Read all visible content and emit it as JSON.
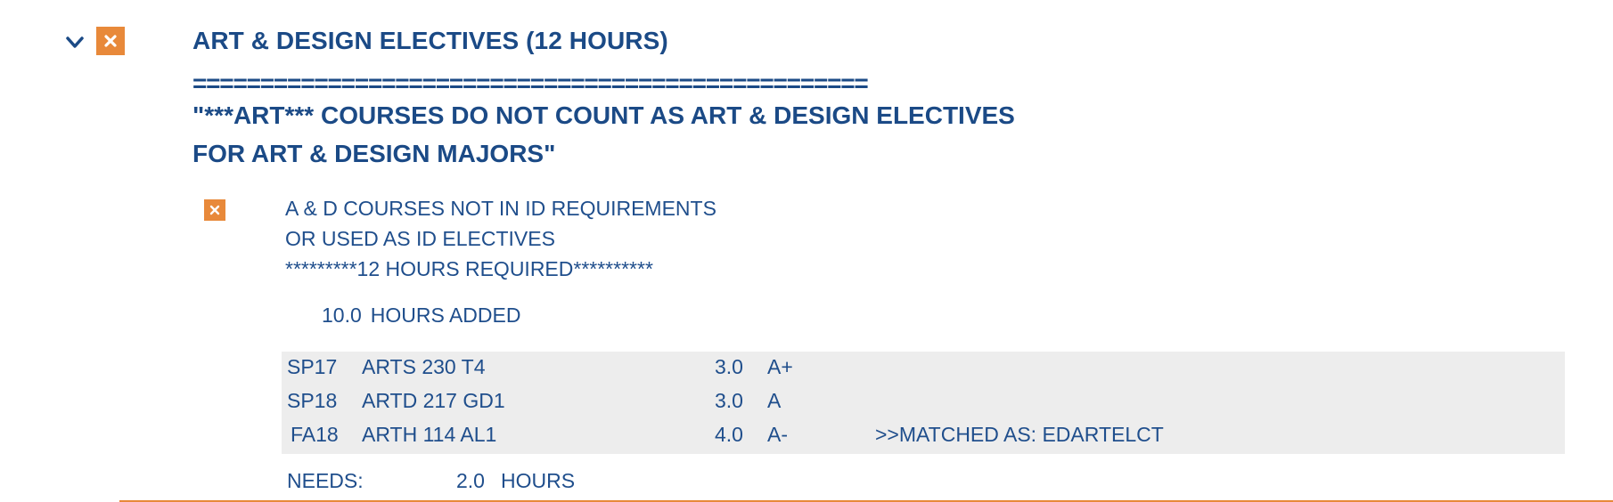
{
  "section": {
    "title": "ART & DESIGN ELECTIVES (12 HOURS)",
    "separator": "==================================================",
    "note_line_1": "\"***ART*** COURSES DO NOT COUNT AS ART & DESIGN ELECTIVES",
    "note_line_2": "FOR ART & DESIGN MAJORS\""
  },
  "requirement": {
    "description_line_1": "A & D COURSES NOT IN ID REQUIREMENTS",
    "description_line_2": "OR USED AS ID ELECTIVES",
    "description_line_3": "*********12 HOURS REQUIRED**********",
    "hours_added_value": "10.0",
    "hours_added_label": "HOURS ADDED",
    "courses": [
      {
        "term": "SP17",
        "course": "ARTS 230 T4",
        "credits": "3.0",
        "grade": "A+",
        "note": ""
      },
      {
        "term": "SP18",
        "course": "ARTD 217 GD1",
        "credits": "3.0",
        "grade": "A",
        "note": ""
      },
      {
        "term": "FA18",
        "course": "ARTH 114 AL1",
        "credits": "4.0",
        "grade": "A-",
        "note": ">>MATCHED AS: EDARTELCT"
      }
    ],
    "needs_label": "NEEDS:",
    "needs_value": "2.0",
    "needs_unit": "HOURS"
  },
  "icons": {
    "collapse": "chevron-down-icon",
    "status": "close-icon"
  },
  "colors": {
    "primary_text": "#1b4a86",
    "status_badge": "#e8893a",
    "table_background": "#ededed",
    "rule": "#e8893a"
  }
}
